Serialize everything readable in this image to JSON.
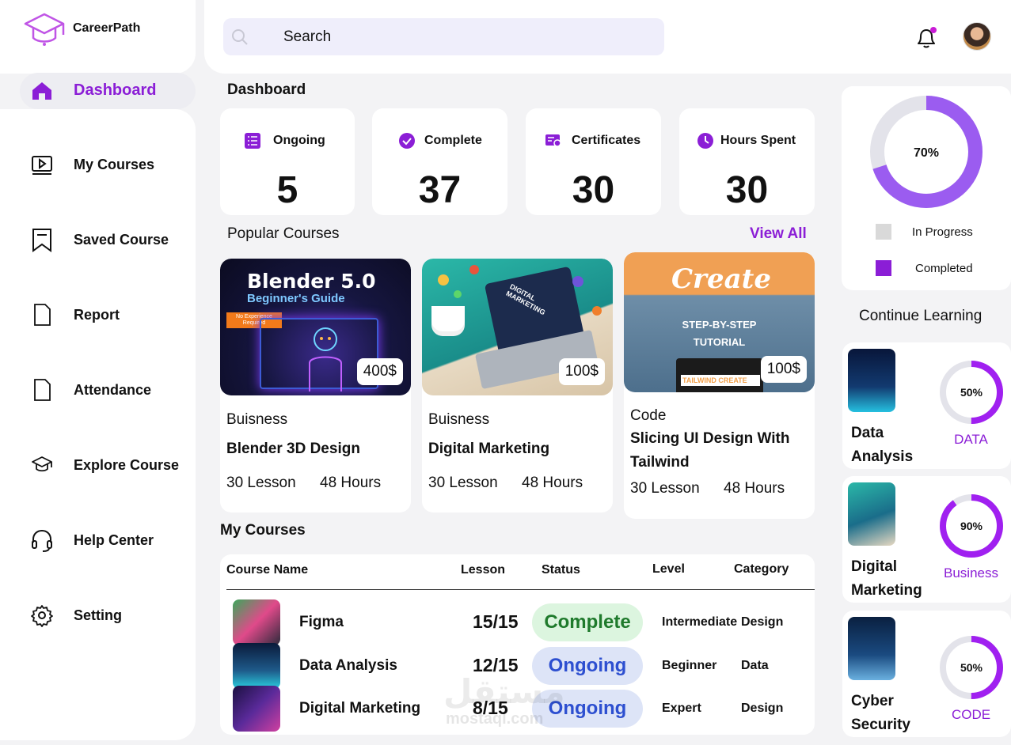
{
  "brand": {
    "name": "CareerPath"
  },
  "nav": {
    "active": {
      "label": "Dashboard",
      "icon": "home-icon"
    },
    "items": [
      {
        "label": "My Courses",
        "icon": "play-video-icon"
      },
      {
        "label": "Saved Course",
        "icon": "bookmark-icon"
      },
      {
        "label": "Report",
        "icon": "document-icon"
      },
      {
        "label": "Attendance",
        "icon": "document-icon"
      },
      {
        "label": "Explore Course",
        "icon": "graduation-cap-icon"
      },
      {
        "label": "Help Center",
        "icon": "headset-icon"
      },
      {
        "label": "Setting",
        "icon": "gear-icon"
      }
    ]
  },
  "header": {
    "search_placeholder": "Search",
    "bell_icon": "bell-icon",
    "accent": "#8b1ed6"
  },
  "dashboard": {
    "title": "Dashboard",
    "stats": [
      {
        "label": "Ongoing",
        "value": "5",
        "icon": "list-icon"
      },
      {
        "label": "Complete",
        "value": "37",
        "icon": "check-circle-icon"
      },
      {
        "label": "Certificates",
        "value": "30",
        "icon": "certificate-icon"
      },
      {
        "label": "Hours Spent",
        "value": "30",
        "icon": "clock-icon"
      }
    ]
  },
  "popular": {
    "title": "Popular Courses",
    "view_all": "View All",
    "courses": [
      {
        "category": "Buisness",
        "title": "Blender 3D Design",
        "lessons": "30 Lesson",
        "hours": "48 Hours",
        "price": "400$",
        "thumb_text_1": "Blender 5.0",
        "thumb_text_2": "Beginner's Guide",
        "thumb_text_3": "No Experience Required"
      },
      {
        "category": "Buisness",
        "title": "Digital Marketing",
        "lessons": "30 Lesson",
        "hours": "48 Hours",
        "price": "100$",
        "thumb_text_1": "DIGITAL MARKETING"
      },
      {
        "category": "Code",
        "title": "Slicing UI Design With Tailwind",
        "lessons": "30 Lesson",
        "hours": "48 Hours",
        "price": "100$",
        "thumb_text_1": "Create",
        "thumb_text_2": "STEP-BY-STEP",
        "thumb_text_3": "TUTORIAL",
        "thumb_text_4": "TAILWIND CREATE"
      }
    ]
  },
  "my_courses": {
    "title": "My Courses",
    "columns": [
      "Course Name",
      "Lesson",
      "Status",
      "Level",
      "Category"
    ],
    "rows": [
      {
        "name": "Figma",
        "lesson": "15/15",
        "status": "Complete",
        "level": "Intermediate",
        "category": "Design"
      },
      {
        "name": "Data Analysis",
        "lesson": "12/15",
        "status": "Ongoing",
        "level": "Beginner",
        "category": "Data"
      },
      {
        "name": "Digital Marketing",
        "lesson": "8/15",
        "status": "Ongoing",
        "level": "Expert",
        "category": "Design"
      }
    ]
  },
  "progress": {
    "percent": 70,
    "label": "70%",
    "legend": [
      {
        "label": "In Progress",
        "color": "#d9d9d9"
      },
      {
        "label": "Completed",
        "color": "#8b1ed6"
      }
    ]
  },
  "continue_learning": {
    "title": "Continue Learning",
    "items": [
      {
        "name": "Data Analysis",
        "percent": 50,
        "label": "50%",
        "tag": "DATA"
      },
      {
        "name": "Digital Marketing",
        "percent": 90,
        "label": "90%",
        "tag": "Business"
      },
      {
        "name": "Cyber Security",
        "percent": 50,
        "label": "50%",
        "tag": "CODE"
      }
    ]
  },
  "watermark": {
    "arabic": "مستقل",
    "latin": "mostaql.com"
  }
}
